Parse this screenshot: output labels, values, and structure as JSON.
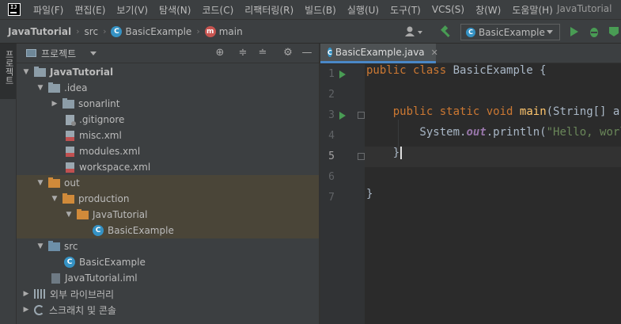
{
  "menu": {
    "items": [
      "파일(F)",
      "편집(E)",
      "보기(V)",
      "탐색(N)",
      "코드(C)",
      "리팩터링(R)",
      "빌드(B)",
      "실행(U)",
      "도구(T)",
      "VCS(S)",
      "창(W)",
      "도움말(H)"
    ],
    "window_title": "JavaTutorial"
  },
  "navbar": {
    "breadcrumbs": [
      "JavaTutorial",
      "src",
      "BasicExample",
      "main"
    ],
    "run_config": "BasicExample"
  },
  "toolstrip": {
    "project_tab": "프로젝트"
  },
  "project_panel": {
    "title": "프로젝트",
    "tree": [
      {
        "label": "JavaTutorial",
        "depth": 0,
        "expanded": true,
        "icon": "folder-icon",
        "kind": "module"
      },
      {
        "label": ".idea",
        "depth": 1,
        "expanded": true,
        "icon": "folder-icon"
      },
      {
        "label": "sonarlint",
        "depth": 2,
        "expanded": false,
        "icon": "folder-icon"
      },
      {
        "label": ".gitignore",
        "depth": 2,
        "icon": "gitignore-file-icon"
      },
      {
        "label": "misc.xml",
        "depth": 2,
        "icon": "xml-file-icon"
      },
      {
        "label": "modules.xml",
        "depth": 2,
        "icon": "xml-file-icon"
      },
      {
        "label": "workspace.xml",
        "depth": 2,
        "icon": "xml-file-icon"
      },
      {
        "label": "out",
        "depth": 1,
        "expanded": true,
        "icon": "folder-icon",
        "excluded": true
      },
      {
        "label": "production",
        "depth": 2,
        "expanded": true,
        "icon": "folder-icon",
        "excluded": true
      },
      {
        "label": "JavaTutorial",
        "depth": 3,
        "expanded": true,
        "icon": "folder-icon",
        "excluded": true
      },
      {
        "label": "BasicExample",
        "depth": 4,
        "icon": "class-icon",
        "excluded": true
      },
      {
        "label": "src",
        "depth": 1,
        "expanded": true,
        "icon": "source-folder-icon"
      },
      {
        "label": "BasicExample",
        "depth": 2,
        "icon": "class-icon"
      },
      {
        "label": "JavaTutorial.iml",
        "depth": 1,
        "icon": "iml-file-icon"
      },
      {
        "label": "외부 라이브러리",
        "depth": 0,
        "expanded": false,
        "icon": "library-icon"
      },
      {
        "label": "스크래치 및 콘솔",
        "depth": 0,
        "expanded": false,
        "icon": "scratch-icon"
      }
    ]
  },
  "editor": {
    "tab_label": "BasicExample.java",
    "current_line": 5,
    "lines": [
      {
        "no": "1",
        "tokens": [
          [
            "kw",
            "public "
          ],
          [
            "kw",
            "class "
          ],
          [
            "cls",
            "BasicExample "
          ],
          [
            "cls",
            "{"
          ]
        ]
      },
      {
        "no": "2",
        "tokens": []
      },
      {
        "no": "3",
        "tokens": [
          [
            "cls",
            "    "
          ],
          [
            "kw",
            "public "
          ],
          [
            "kw",
            "static "
          ],
          [
            "kw",
            "void "
          ],
          [
            "fn",
            "main"
          ],
          [
            "cls",
            "(String[] args) {"
          ]
        ]
      },
      {
        "no": "4",
        "tokens": [
          [
            "cls",
            "        System."
          ],
          [
            "fld",
            "out"
          ],
          [
            "cls",
            ".println("
          ],
          [
            "str",
            "\"Hello, world!\""
          ],
          [
            "cls",
            ");"
          ]
        ]
      },
      {
        "no": "5",
        "tokens": [
          [
            "cls",
            "    }"
          ]
        ]
      },
      {
        "no": "6",
        "tokens": []
      },
      {
        "no": "7",
        "tokens": [
          [
            "cls",
            "}"
          ]
        ]
      }
    ]
  },
  "colors": {
    "background": "#2b2b2b",
    "panel": "#3c3f41",
    "keyword": "#cc7832",
    "method": "#ffc66d",
    "string": "#6a8759",
    "static_field": "#9876aa",
    "excluded_highlight": "#4a4538",
    "accent": "#4a88c7",
    "run": "#499c54"
  }
}
